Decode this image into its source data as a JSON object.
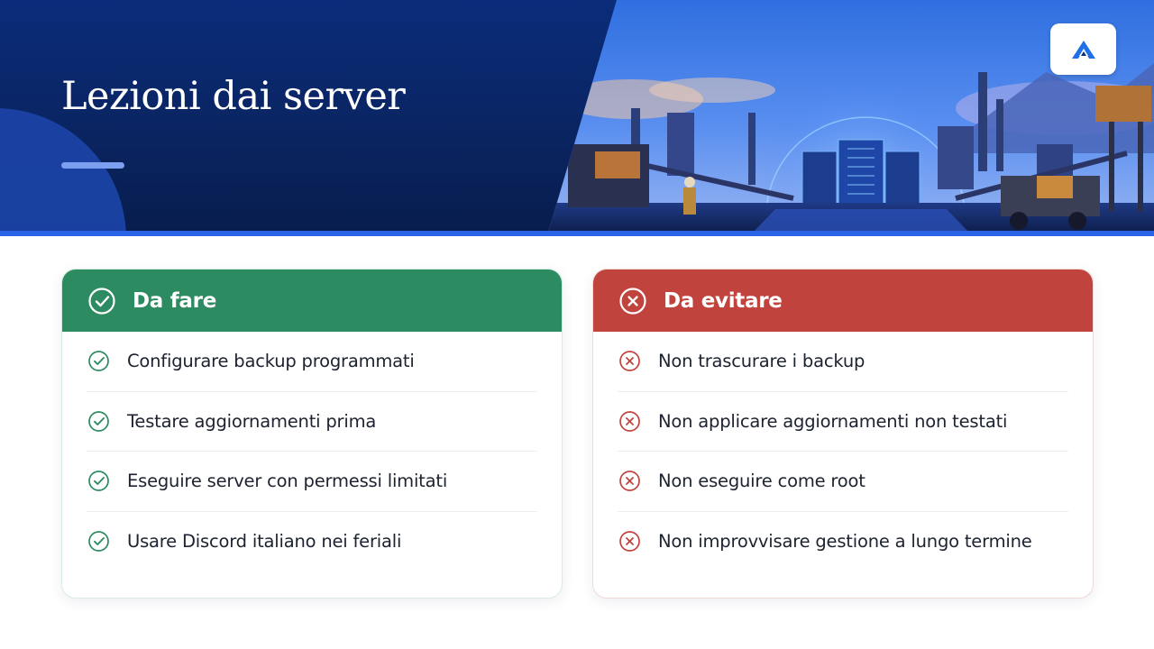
{
  "header": {
    "title": "Lezioni dai server",
    "logo_icon": "logo-a-icon",
    "illustration": "industrial-server-city-illustration"
  },
  "colors": {
    "header_bg": "#0a2c7a",
    "accent_line": "#2a63e6",
    "do_green": "#2c8b60",
    "dont_red": "#c0443d"
  },
  "cards": {
    "do": {
      "title": "Da fare",
      "icon": "check-circle-icon",
      "items": [
        "Configurare backup programmati",
        "Testare aggiornamenti prima",
        "Eseguire server con permessi limitati",
        "Usare Discord italiano nei feriali"
      ]
    },
    "dont": {
      "title": "Da evitare",
      "icon": "x-circle-icon",
      "items": [
        "Non trascurare i backup",
        "Non applicare aggiornamenti non testati",
        "Non eseguire come root",
        "Non improvvisare gestione a lungo termine"
      ]
    }
  }
}
